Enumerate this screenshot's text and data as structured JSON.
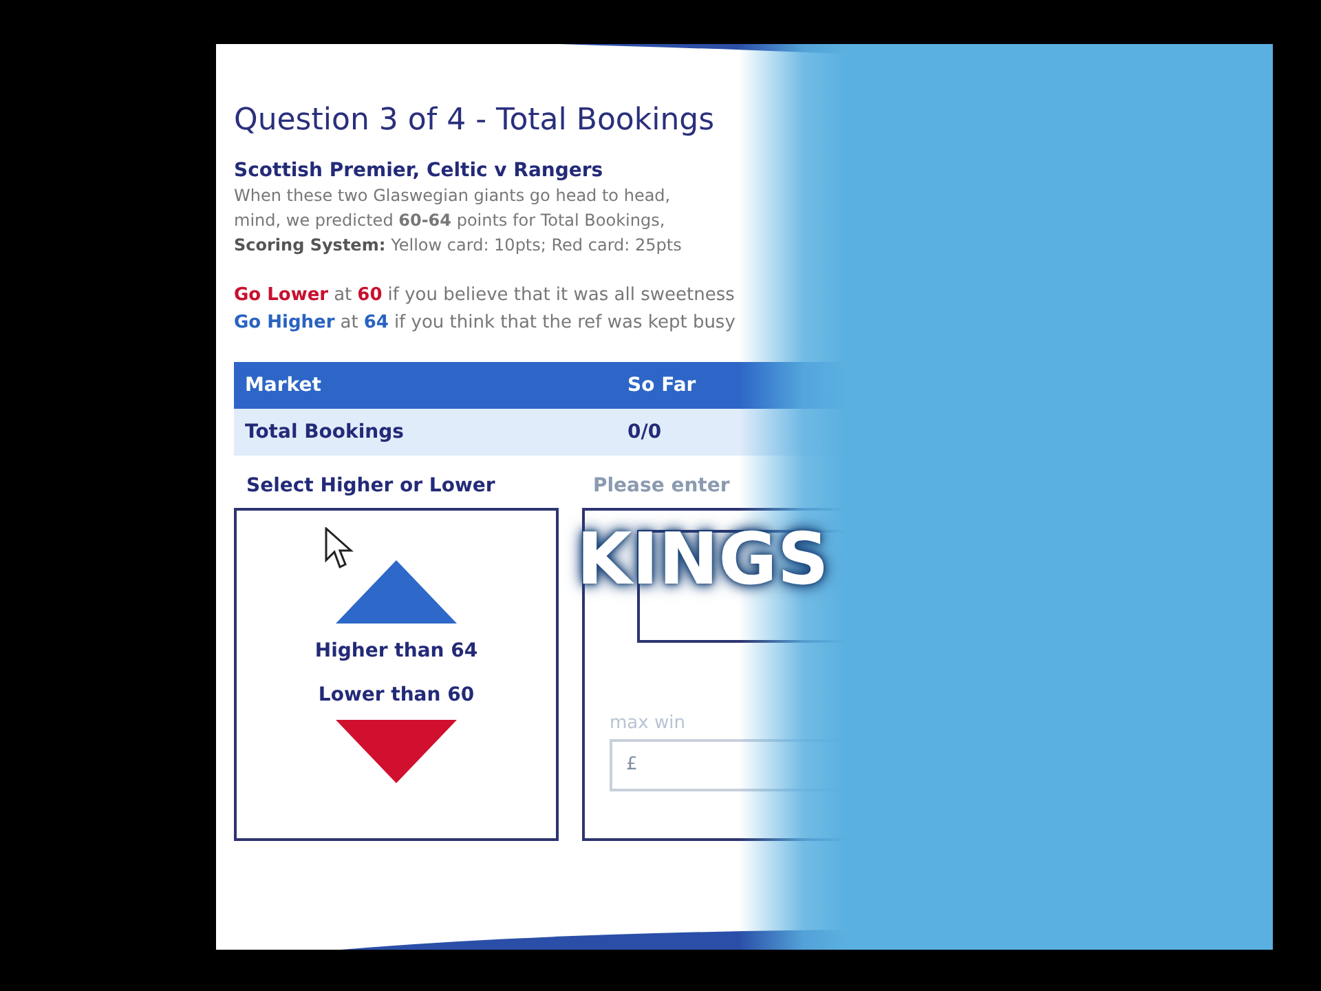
{
  "question_title": "Question 3 of 4 - Total Bookings",
  "match": "Scottish Premier, Celtic v Rangers",
  "description": [
    "When these two Glaswegian giants go head to head,",
    "mind, we predicted **60-64** points for Total Bookings,"
  ],
  "scoring": {
    "label": "Scoring System:",
    "text": "Yellow card: 10pts; Red card: 25pts"
  },
  "calls": [
    {
      "kind": "lower",
      "action": "Go Lower",
      "at": "at",
      "value": "60",
      "rest": "if you believe that it was all sweetness"
    },
    {
      "kind": "higher",
      "action": "Go Higher",
      "at": "at",
      "value": "64",
      "rest": "if you think that the ref was kept busy"
    }
  ],
  "table": {
    "columns": [
      "Market",
      "So Far"
    ],
    "rows": [
      [
        "Total Bookings",
        "0/0"
      ]
    ]
  },
  "select_label": "Select Higher or Lower",
  "choices": [
    {
      "kind": "higher",
      "label": "Higher than 64"
    },
    {
      "kind": "lower",
      "label": "Lower than 60"
    }
  ],
  "stake": {
    "prompt": "Please enter",
    "max_win_label": "max win",
    "currency": "£"
  },
  "overlay_text": "KINGS"
}
